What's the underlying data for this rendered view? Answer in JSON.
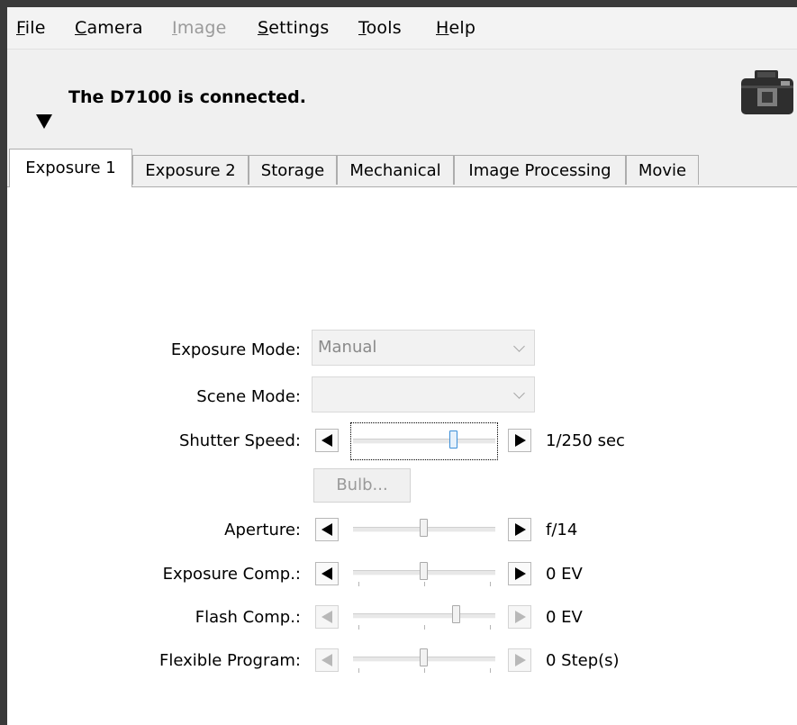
{
  "menu": {
    "items": [
      {
        "label": "File",
        "underline": "F",
        "rest": "ile",
        "disabled": false
      },
      {
        "label": "Camera",
        "underline": "C",
        "rest": "amera",
        "disabled": false
      },
      {
        "label": "Image",
        "underline": "I",
        "rest": "mage",
        "disabled": true
      },
      {
        "label": "Settings",
        "underline": "S",
        "rest": "ettings",
        "disabled": false
      },
      {
        "label": "Tools",
        "underline": "T",
        "rest": "ools",
        "disabled": false
      },
      {
        "label": "Help",
        "underline": "H",
        "rest": "elp",
        "disabled": false
      }
    ]
  },
  "header": {
    "status": "The D7100 is connected.",
    "camera_icon": "camera-icon",
    "collapse_icon": "triangle-down-icon"
  },
  "tabs": [
    "Exposure 1",
    "Exposure 2",
    "Storage",
    "Mechanical",
    "Image Processing",
    "Movie"
  ],
  "active_tab": "Exposure 1",
  "exposure": {
    "exposure_mode": {
      "label": "Exposure Mode:",
      "value": "Manual",
      "enabled": false
    },
    "scene_mode": {
      "label": "Scene Mode:",
      "value": "",
      "enabled": false
    },
    "shutter_speed": {
      "label": "Shutter Speed:",
      "value": "1/250 sec",
      "position": 0.71,
      "enabled": true,
      "focused": true
    },
    "bulb_button": {
      "label": "Bulb...",
      "enabled": false
    },
    "aperture": {
      "label": "Aperture:",
      "value": "f/14",
      "position": 0.5,
      "enabled": true
    },
    "exposure_comp": {
      "label": "Exposure Comp.:",
      "value": "0 EV",
      "position": 0.5,
      "enabled": true
    },
    "flash_comp": {
      "label": "Flash Comp.:",
      "value": "0 EV",
      "position": 0.73,
      "enabled": false
    },
    "flexible_program": {
      "label": "Flexible Program:",
      "value": "0 Step(s)",
      "position": 0.5,
      "enabled": false
    }
  },
  "colors": {
    "window_bg": "#ffffff",
    "chrome_bg": "#f0f0f0",
    "disabled_text": "#9a9a9a",
    "focus_thumb": "#3c8fd8"
  }
}
